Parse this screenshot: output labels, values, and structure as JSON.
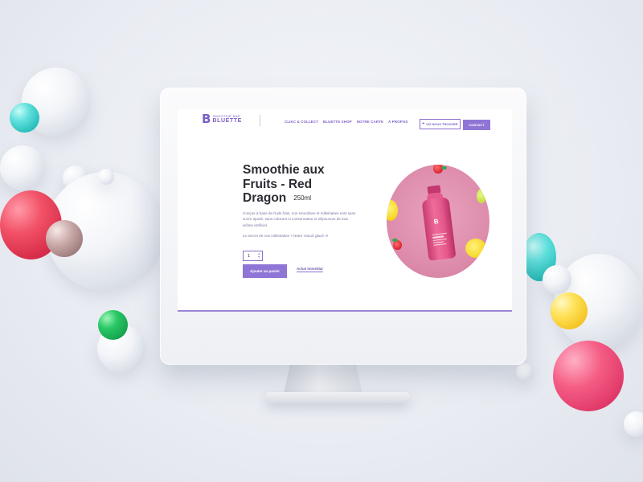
{
  "header": {
    "logo": {
      "mark": "B",
      "small": "SMOOTHIE BAR",
      "big": "BLUETTE"
    },
    "nav": [
      "CLIKC & COLLECT",
      "BLUETTE SHOP",
      "NOTRE CARTE",
      "À PROPOS"
    ],
    "find_label": "OÙ NOUS TROUVER",
    "contact_label": "CONTACT"
  },
  "product": {
    "title": "Smoothie aux Fruits - Red Dragon",
    "volume": "250ml",
    "description": "Conçus à base de fruits frais, nos smoothies et milkshakes sont sans sucre ajouté, sans colorant ni conservateur et dépourvus de tout arôme artificiel.",
    "secret": "Le secret de nos milkshakes ? Notre Yaourt glacé !!!",
    "quantity": "1",
    "add_to_cart": "Ajouter au panier",
    "buy_now": "Achat immédiat",
    "bottle_logo": "B"
  },
  "colors": {
    "accent": "#8f76d6",
    "text": "#2c2c33",
    "product_bg": "#e29ab7"
  },
  "icons": {
    "pin": "map-pin-icon",
    "up": "chevron-up-icon",
    "down": "chevron-down-icon"
  }
}
